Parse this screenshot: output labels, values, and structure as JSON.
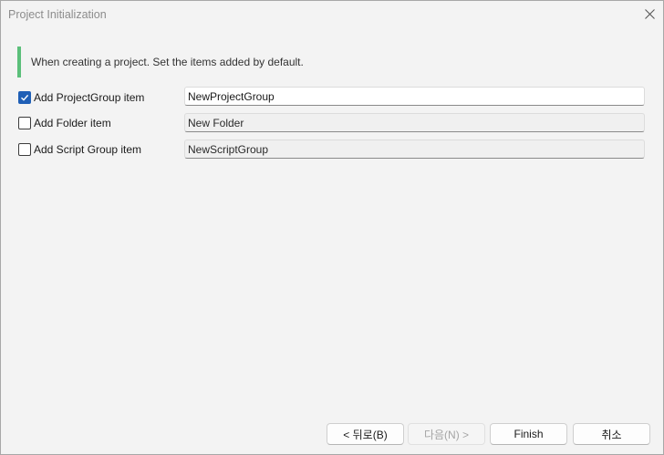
{
  "window": {
    "title": "Project Initialization"
  },
  "banner": {
    "text": "When creating a project. Set the items added by default.",
    "accent_color": "#5bbf7a"
  },
  "items": [
    {
      "label": "Add ProjectGroup item",
      "checked": true,
      "value": "NewProjectGroup"
    },
    {
      "label": "Add Folder item",
      "checked": false,
      "value": "New Folder"
    },
    {
      "label": "Add Script Group item",
      "checked": false,
      "value": "NewScriptGroup"
    }
  ],
  "buttons": {
    "back": "< 뒤로(B)",
    "next": "다음(N) >",
    "finish": "Finish",
    "cancel": "취소"
  },
  "colors": {
    "checkbox_checked": "#1f5fb6",
    "background": "#f3f3f3"
  }
}
